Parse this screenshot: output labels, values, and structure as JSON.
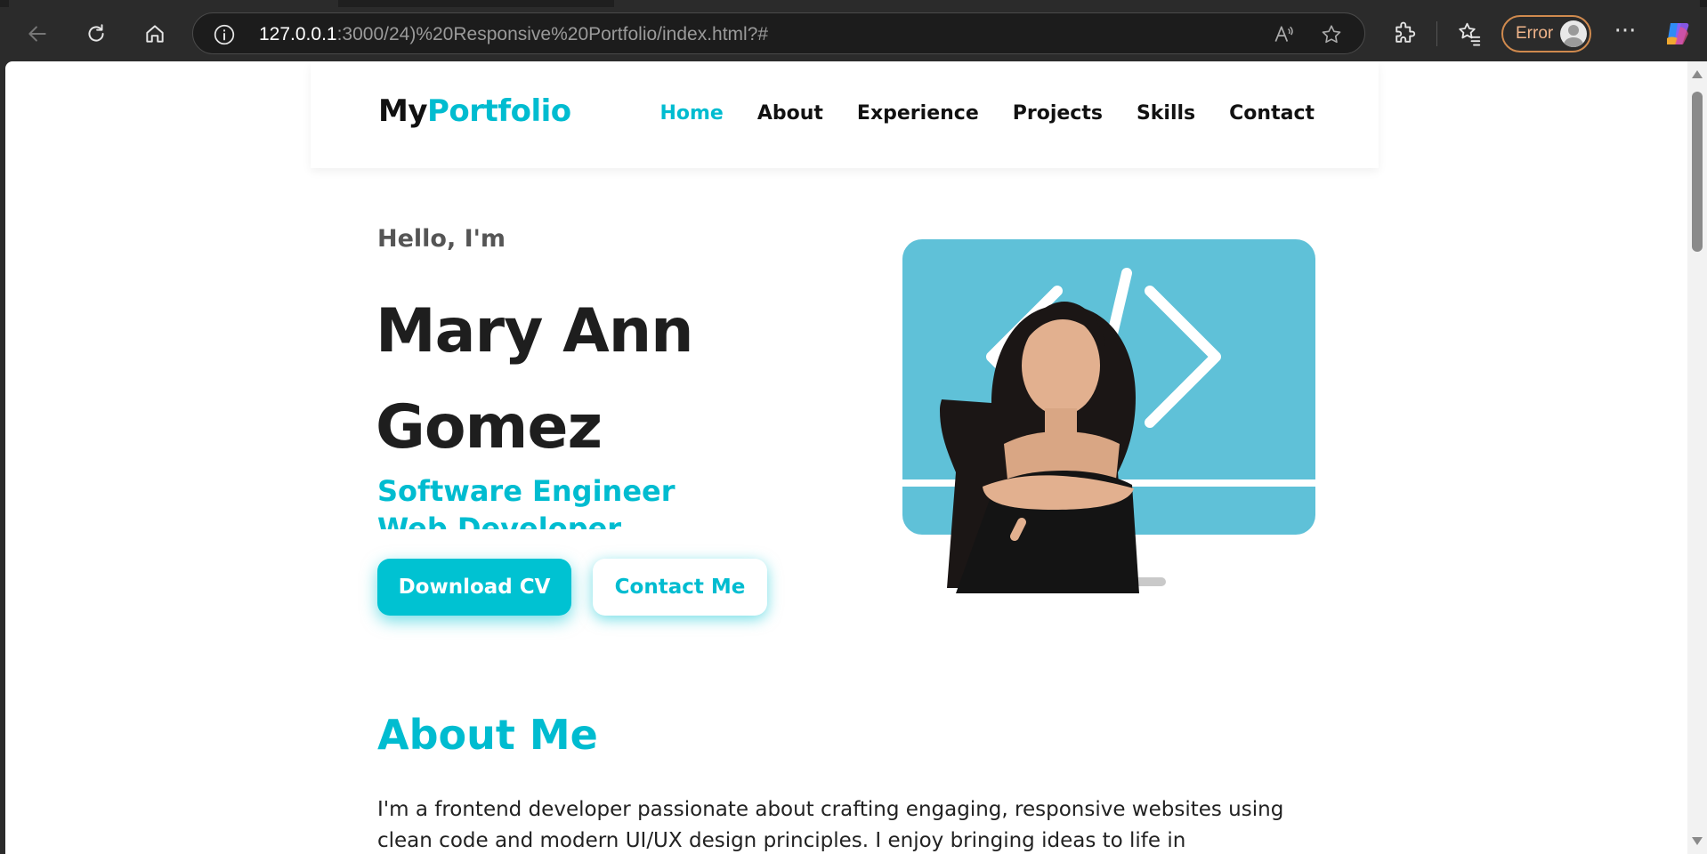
{
  "browser": {
    "url_host": "127.0.0.1",
    "url_rest": ":3000/24)%20Responsive%20Portfolio/index.html?#",
    "profile_label": "Error",
    "icons": [
      "back-icon",
      "refresh-icon",
      "home-icon",
      "info-icon",
      "read-aloud-icon",
      "favorite-star-icon",
      "extensions-icon",
      "favorites-icon",
      "more-icon",
      "copilot-icon"
    ]
  },
  "nav": {
    "logo_prefix": "My",
    "logo_accent": "Portfolio",
    "links": [
      {
        "label": "Home",
        "active": true
      },
      {
        "label": "About",
        "active": false
      },
      {
        "label": "Experience",
        "active": false
      },
      {
        "label": "Projects",
        "active": false
      },
      {
        "label": "Skills",
        "active": false
      },
      {
        "label": "Contact",
        "active": false
      }
    ]
  },
  "hero": {
    "greeting": "Hello, I'm",
    "name_line1": "Mary Ann",
    "name_line2": "Gomez",
    "roles": [
      "Software Engineer",
      "Web Developer"
    ],
    "cv_button": "Download CV",
    "contact_button": "Contact Me"
  },
  "about": {
    "title": "About Me",
    "text": "I'm a frontend developer passionate about crafting engaging, responsive websites using clean code and modern UI/UX design principles. I enjoy bringing ideas to life in"
  },
  "colors": {
    "accent": "#00bcd0",
    "monitor": "#5fc1d8",
    "chrome": "#2b2b2b"
  }
}
